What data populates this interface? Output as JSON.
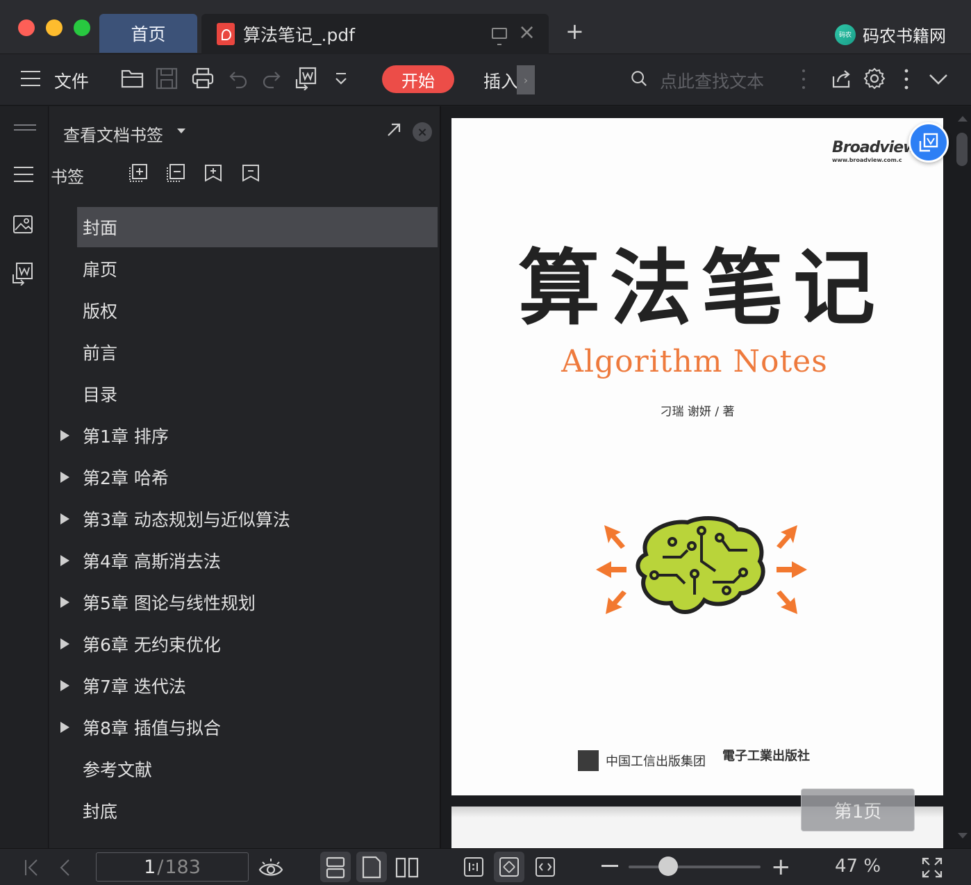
{
  "tabs": {
    "home": "首页",
    "document": "算法笔记_.pdf",
    "brand_logo_text": "码农",
    "brand_name": "码农书籍网"
  },
  "toolbar": {
    "file_label": "文件",
    "start_label": "开始",
    "insert_label": "插入",
    "insert_more": "›",
    "search_placeholder": "点此查找文本"
  },
  "panel": {
    "title": "查看文档书签",
    "close": "×",
    "bookmarks_label": "书签",
    "bookmarks": [
      {
        "label": "封面",
        "expandable": false,
        "selected": true
      },
      {
        "label": "扉页",
        "expandable": false,
        "selected": false
      },
      {
        "label": "版权",
        "expandable": false,
        "selected": false
      },
      {
        "label": "前言",
        "expandable": false,
        "selected": false
      },
      {
        "label": "目录",
        "expandable": false,
        "selected": false
      },
      {
        "label": "第1章 排序",
        "expandable": true,
        "selected": false
      },
      {
        "label": "第2章 哈希",
        "expandable": true,
        "selected": false
      },
      {
        "label": "第3章 动态规划与近似算法",
        "expandable": true,
        "selected": false
      },
      {
        "label": "第4章 高斯消去法",
        "expandable": true,
        "selected": false
      },
      {
        "label": "第5章 图论与线性规划",
        "expandable": true,
        "selected": false
      },
      {
        "label": "第6章 无约束优化",
        "expandable": true,
        "selected": false
      },
      {
        "label": "第7章 迭代法",
        "expandable": true,
        "selected": false
      },
      {
        "label": "第8章 插值与拟合",
        "expandable": true,
        "selected": false
      },
      {
        "label": "参考文献",
        "expandable": false,
        "selected": false
      },
      {
        "label": "封底",
        "expandable": false,
        "selected": false
      }
    ]
  },
  "document": {
    "publisher_brand": "Broadview",
    "publisher_url": "www.broadview.com.c",
    "title": "算法笔记",
    "subtitle": "Algorithm Notes",
    "authors": "刁瑞  谢妍 / 著",
    "publisher_group": "中国工信出版集团",
    "publisher_house": "電子工業出版社",
    "page_badge": "第1页"
  },
  "status": {
    "current_page": "1",
    "separator": "/",
    "total_pages": "183",
    "zoom": "47 %",
    "zoom_fraction": 0.3
  },
  "colors": {
    "accent_red": "#ec4d48",
    "home_tab": "#3c5278",
    "float_button": "#2d7ff5",
    "subtitle_orange": "#ee7a3d",
    "brain_green": "#b9d43a"
  }
}
